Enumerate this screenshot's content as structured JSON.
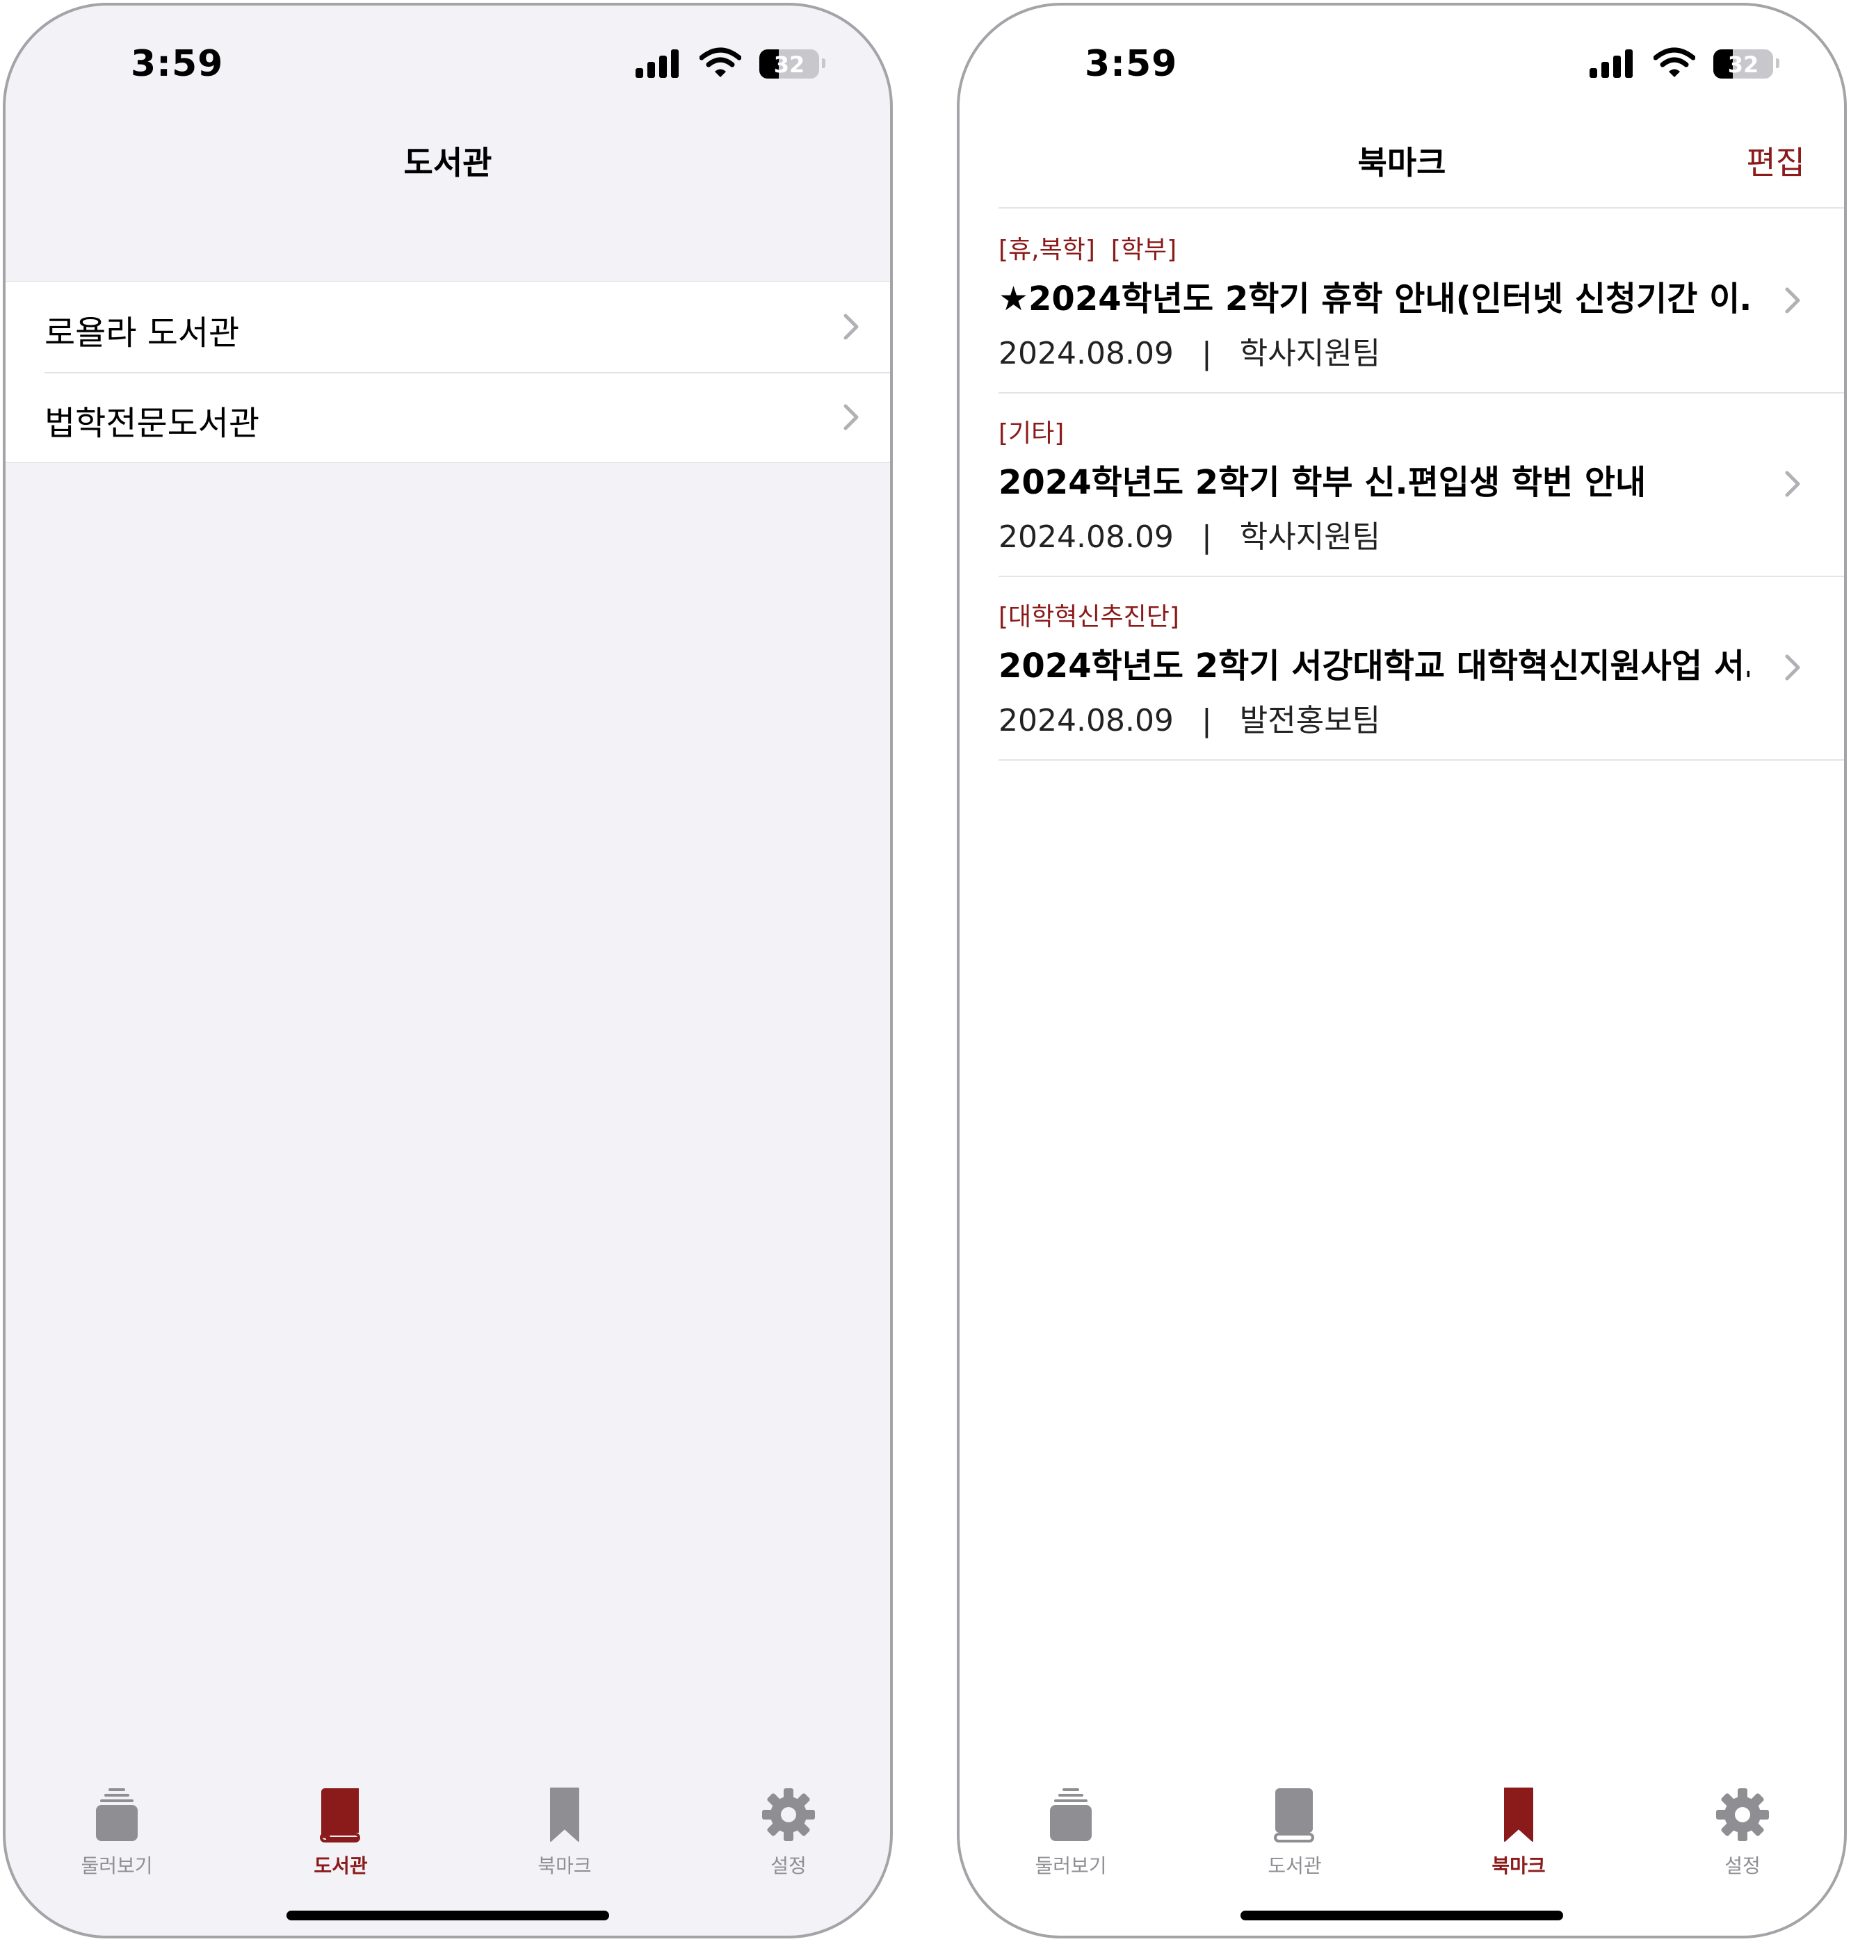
{
  "colors": {
    "accent": "#8b1a1a",
    "inactive": "#8e8e93",
    "grouped_bg": "#f2f2f7"
  },
  "status_bar": {
    "time": "3:59",
    "battery": "32",
    "battery_level": 0.32
  },
  "library_screen": {
    "title": "도서관",
    "items": [
      {
        "label": "로욜라 도서관"
      },
      {
        "label": "법학전문도서관"
      }
    ]
  },
  "bookmark_screen": {
    "title": "북마크",
    "edit_label": "편집",
    "items": [
      {
        "tags": "[휴,복학]  [학부]",
        "title": "★2024학년도 2학기 휴학 안내(인터넷 신청기간 이…",
        "date": "2024.08.09",
        "separator": "|",
        "department": "학사지원팀"
      },
      {
        "tags": "[기타]",
        "title": "2024학년도 2학기 학부 신.편입생 학번 안내",
        "date": "2024.08.09",
        "separator": "|",
        "department": "학사지원팀"
      },
      {
        "tags": "[대학혁신추진단]",
        "title": "2024학년도 2학기 서강대학교 대학혁신지원사업 서…",
        "date": "2024.08.09",
        "separator": "|",
        "department": "발전홍보팀"
      }
    ]
  },
  "tab_bar": {
    "tabs": [
      {
        "label": "둘러보기",
        "icon": "stack-icon"
      },
      {
        "label": "도서관",
        "icon": "book-icon"
      },
      {
        "label": "북마크",
        "icon": "bookmark-icon"
      },
      {
        "label": "설정",
        "icon": "gear-icon"
      }
    ]
  }
}
